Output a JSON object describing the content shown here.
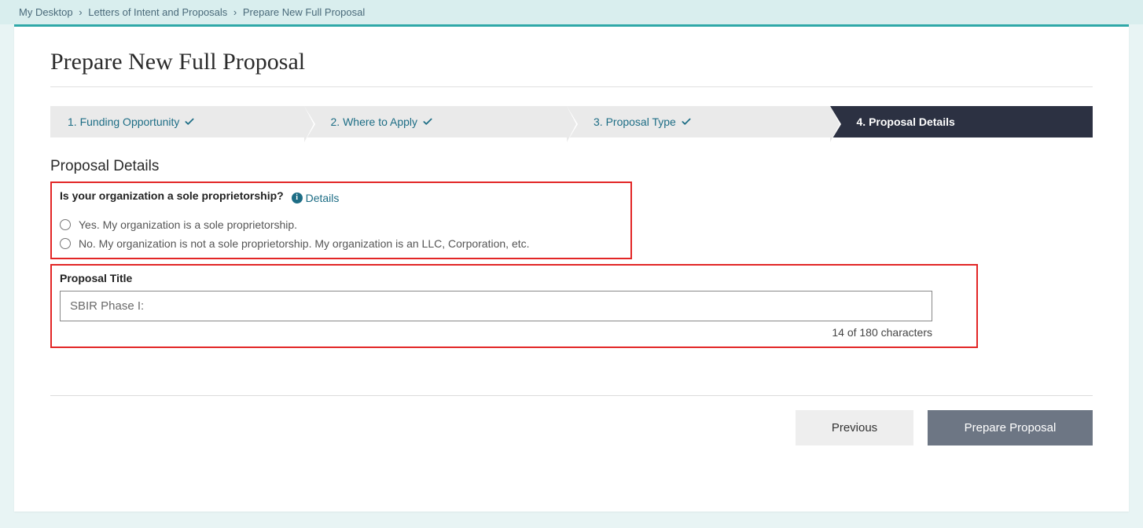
{
  "breadcrumb": {
    "items": [
      "My Desktop",
      "Letters of Intent and Proposals",
      "Prepare New Full Proposal"
    ]
  },
  "page": {
    "title": "Prepare New Full Proposal"
  },
  "stepper": {
    "steps": [
      {
        "label": "1. Funding Opportunity",
        "done": true
      },
      {
        "label": "2. Where to Apply",
        "done": true
      },
      {
        "label": "3. Proposal Type",
        "done": true
      },
      {
        "label": "4. Proposal Details",
        "active": true
      }
    ]
  },
  "section": {
    "heading": "Proposal Details",
    "question": "Is your organization a sole proprietorship?",
    "details_link": "Details",
    "option_yes": "Yes. My organization is a sole proprietorship.",
    "option_no": "No. My organization is not a sole proprietorship. My organization is an LLC, Corporation, etc.",
    "title_label": "Proposal Title",
    "title_value": "SBIR Phase I:",
    "char_count": "14 of 180 characters"
  },
  "buttons": {
    "previous": "Previous",
    "prepare": "Prepare Proposal"
  }
}
